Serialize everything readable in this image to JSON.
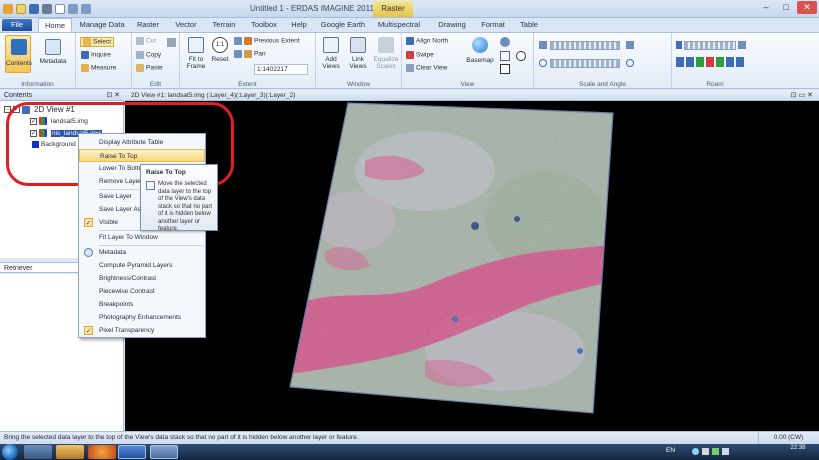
{
  "window": {
    "title": "Untitled 1 - ERDAS IMAGINE 2011",
    "context_tab": "Raster"
  },
  "tabs": [
    "File",
    "Home",
    "Manage Data",
    "Raster",
    "Vector",
    "Terrain",
    "Toolbox",
    "Help",
    "Google Earth",
    "Multispectral",
    "Drawing",
    "Format",
    "Table"
  ],
  "ribbon": {
    "information": {
      "label": "Information",
      "contents": "Contents",
      "metadata": "Metadata"
    },
    "select_group": {
      "select": "Select",
      "inquire": "Inquire",
      "measure": "Measure"
    },
    "edit": {
      "label": "Edit",
      "cut": "Cut",
      "copy": "Copy",
      "paste": "Paste"
    },
    "extent": {
      "label": "Extent",
      "fit_to_frame": "Fit to Frame",
      "reset": "Reset",
      "previous_extent": "Previous Extent",
      "pan": "Pan",
      "scale_value": "1:1402217"
    },
    "window_group": {
      "label": "Window",
      "add_views": "Add Views",
      "link_views": "Link Views",
      "equalize_scales": "Equalize Scales"
    },
    "view": {
      "label": "View",
      "align_north": "Align North",
      "swipe": "Swipe",
      "clear_view": "Clear View",
      "basemap": "Basemap"
    },
    "scale_angle": {
      "label": "Scale and Angle"
    },
    "roam": {
      "label": "Roam"
    }
  },
  "contents_panel": {
    "title": "Contents",
    "view_label": "2D View #1",
    "layers": [
      "landsat5.img",
      "nis_landsat5.img",
      "Background"
    ]
  },
  "retriever_panel": {
    "title": "Retriever"
  },
  "view_header": "2D View #1: landsat5.img (:Layer_4)(:Layer_3)(:Layer_2)",
  "context_menu": {
    "items": [
      "Display Attribute Table",
      "Raise To Top",
      "Lower To Bottom",
      "Remove Layer",
      "Save Layer",
      "Save Layer As...",
      "Visible",
      "Fit Layer To Window",
      "Metadata",
      "Compute Pyramid Layers",
      "Brightness/Contrast",
      "Piecewise Contrast",
      "Breakpoints",
      "Photography Enhancements",
      "Pixel Transparency"
    ]
  },
  "tooltip": {
    "title": "Raise To Top",
    "body": "Move the selected data layer to the top of the View's data stack so that no part of it is hidden below another layer or feature."
  },
  "statusbar": {
    "message": "Bring the selected data layer to the top of the View's data stack so that no part of it is hidden below another layer or feature.",
    "coordinate": "0.00 (CW)"
  },
  "taskbar": {
    "language": "EN",
    "time": "22:38"
  },
  "colors": {
    "ribbon_bg": "#e3ecf7",
    "highlight": "#f7d97a",
    "annotation": "#e01f1f",
    "image_magenta": "#c8457c",
    "image_green": "#9aa79c"
  }
}
